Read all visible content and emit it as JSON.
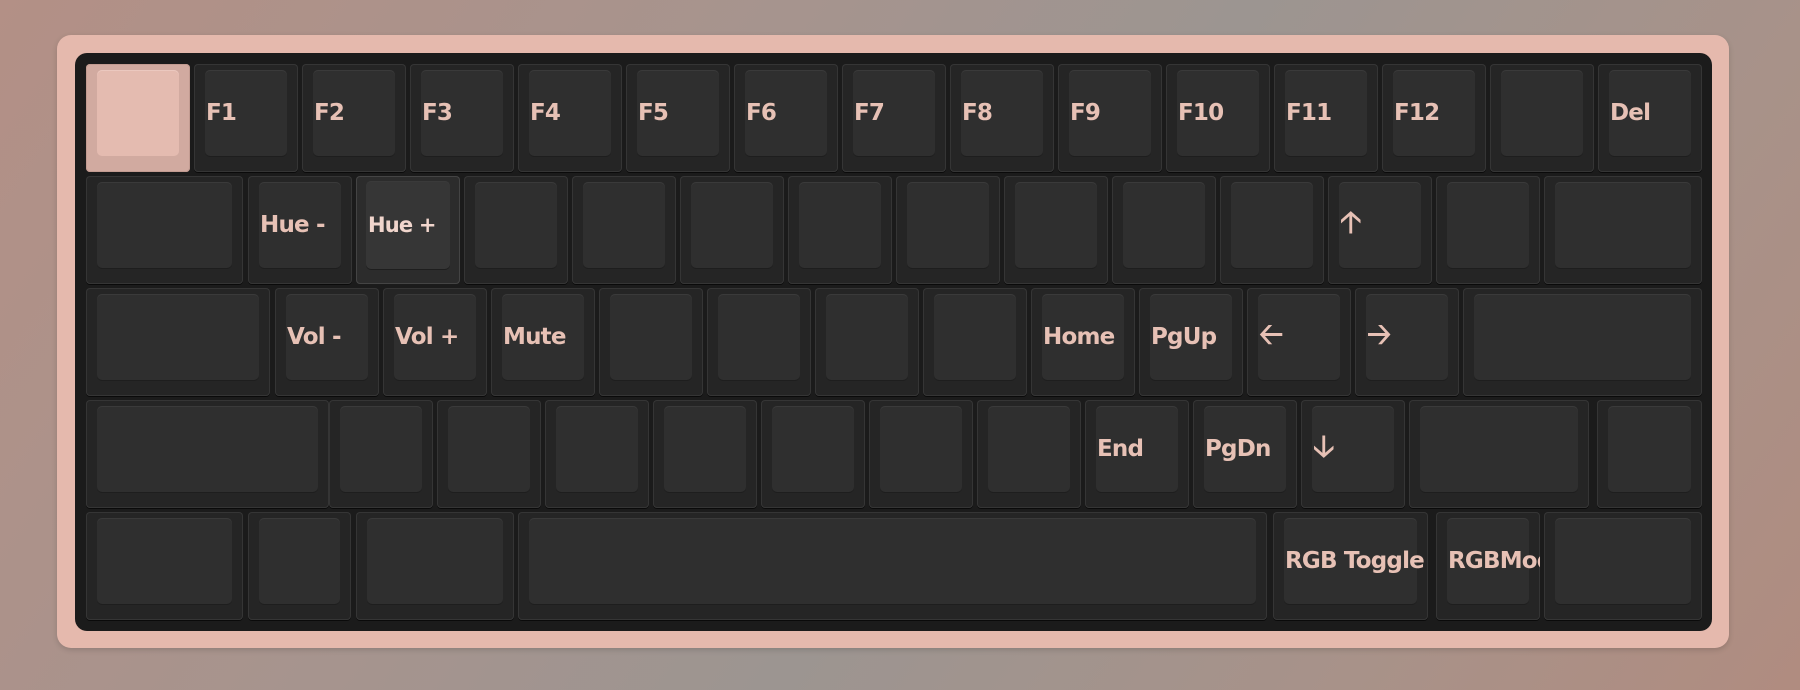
{
  "keyboard": {
    "colors": {
      "case": "#e5b9ad",
      "plate": "#1b1b1b",
      "keycap": "#2f2f2f",
      "legend": "#e7c1b5",
      "selected": "#e4bbb0"
    },
    "rows": [
      [
        {
          "name": "key-r0-c0",
          "label": "",
          "state": "selected"
        },
        {
          "name": "key-f1",
          "label": "F1"
        },
        {
          "name": "key-f2",
          "label": "F2"
        },
        {
          "name": "key-f3",
          "label": "F3"
        },
        {
          "name": "key-f4",
          "label": "F4"
        },
        {
          "name": "key-f5",
          "label": "F5"
        },
        {
          "name": "key-f6",
          "label": "F6"
        },
        {
          "name": "key-f7",
          "label": "F7"
        },
        {
          "name": "key-f8",
          "label": "F8"
        },
        {
          "name": "key-f9",
          "label": "F9"
        },
        {
          "name": "key-f10",
          "label": "F10"
        },
        {
          "name": "key-f11",
          "label": "F11"
        },
        {
          "name": "key-f12",
          "label": "F12"
        },
        {
          "name": "key-r0-c13",
          "label": ""
        },
        {
          "name": "key-del",
          "label": "Del"
        }
      ],
      [
        {
          "name": "key-r1-c0",
          "label": ""
        },
        {
          "name": "key-hue-down",
          "label": "Hue -"
        },
        {
          "name": "key-hue-up",
          "label": "Hue +",
          "state": "hover"
        },
        {
          "name": "key-r1-c3",
          "label": ""
        },
        {
          "name": "key-r1-c4",
          "label": ""
        },
        {
          "name": "key-r1-c5",
          "label": ""
        },
        {
          "name": "key-r1-c6",
          "label": ""
        },
        {
          "name": "key-r1-c7",
          "label": ""
        },
        {
          "name": "key-r1-c8",
          "label": ""
        },
        {
          "name": "key-r1-c9",
          "label": ""
        },
        {
          "name": "key-r1-c10",
          "label": ""
        },
        {
          "name": "key-arrow-up",
          "label": "🡡",
          "icon": "arrow-up-icon"
        },
        {
          "name": "key-r1-c12",
          "label": ""
        },
        {
          "name": "key-r1-c13",
          "label": ""
        }
      ],
      [
        {
          "name": "key-r2-c0",
          "label": ""
        },
        {
          "name": "key-vol-down",
          "label": "Vol -"
        },
        {
          "name": "key-vol-up",
          "label": "Vol +"
        },
        {
          "name": "key-mute",
          "label": "Mute"
        },
        {
          "name": "key-r2-c4",
          "label": ""
        },
        {
          "name": "key-r2-c5",
          "label": ""
        },
        {
          "name": "key-r2-c6",
          "label": ""
        },
        {
          "name": "key-r2-c7",
          "label": ""
        },
        {
          "name": "key-home",
          "label": "Home"
        },
        {
          "name": "key-pgup",
          "label": "PgUp"
        },
        {
          "name": "key-arrow-left",
          "label": "🡠",
          "icon": "arrow-left-icon"
        },
        {
          "name": "key-arrow-right",
          "label": "🡢",
          "icon": "arrow-right-icon"
        },
        {
          "name": "key-r2-c12",
          "label": ""
        }
      ],
      [
        {
          "name": "key-r3-c0",
          "label": ""
        },
        {
          "name": "key-r3-c1",
          "label": ""
        },
        {
          "name": "key-r3-c2",
          "label": ""
        },
        {
          "name": "key-r3-c3",
          "label": ""
        },
        {
          "name": "key-r3-c4",
          "label": ""
        },
        {
          "name": "key-r3-c5",
          "label": ""
        },
        {
          "name": "key-r3-c6",
          "label": ""
        },
        {
          "name": "key-r3-c7",
          "label": ""
        },
        {
          "name": "key-end",
          "label": "End"
        },
        {
          "name": "key-pgdn",
          "label": "PgDn"
        },
        {
          "name": "key-arrow-down",
          "label": "🡣",
          "icon": "arrow-down-icon"
        },
        {
          "name": "key-r3-c11",
          "label": ""
        },
        {
          "name": "key-r3-c12",
          "label": ""
        }
      ],
      [
        {
          "name": "key-r4-c0",
          "label": ""
        },
        {
          "name": "key-r4-c1",
          "label": ""
        },
        {
          "name": "key-r4-c2",
          "label": ""
        },
        {
          "name": "key-space",
          "label": ""
        },
        {
          "name": "key-rgb-toggle",
          "label": "RGB Toggle"
        },
        {
          "name": "key-rgb-mode",
          "label": "RGBMode"
        },
        {
          "name": "key-r4-c6",
          "label": ""
        }
      ]
    ]
  }
}
